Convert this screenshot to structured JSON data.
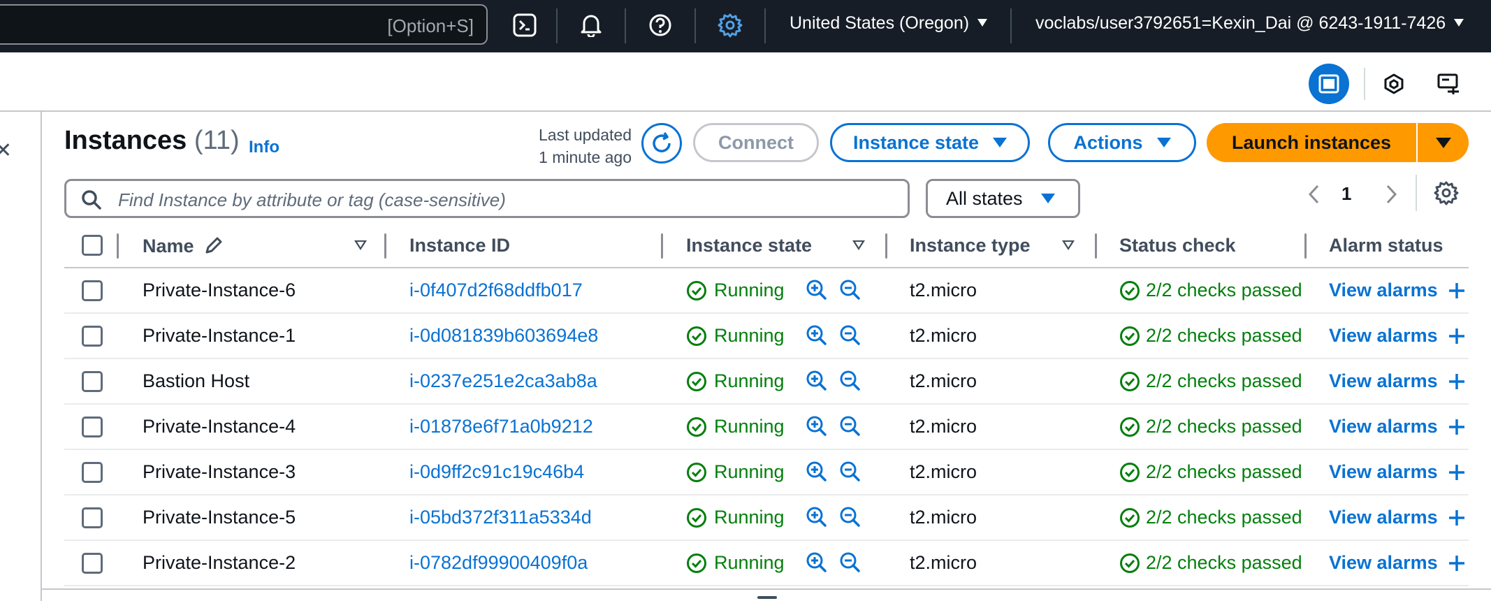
{
  "topnav": {
    "search_shortcut": "[Option+S]",
    "region": "United States (Oregon)",
    "account": "voclabs/user3792651=Kexin_Dai @ 6243-1911-7426"
  },
  "header": {
    "title": "Instances",
    "count": "(11)",
    "info": "Info",
    "last_updated_line1": "Last updated",
    "last_updated_line2": "1 minute ago"
  },
  "buttons": {
    "connect": "Connect",
    "instance_state": "Instance state",
    "actions": "Actions",
    "launch": "Launch instances"
  },
  "filter": {
    "placeholder": "Find Instance by attribute or tag (case-sensitive)",
    "state_select": "All states"
  },
  "pagination": {
    "current_page": "1"
  },
  "columns": {
    "name": "Name",
    "instance_id": "Instance ID",
    "instance_state": "Instance state",
    "instance_type": "Instance type",
    "status_check": "Status check",
    "alarm_status": "Alarm status"
  },
  "rows": [
    {
      "name": "Private-Instance-6",
      "id": "i-0f407d2f68ddfb017",
      "state": "Running",
      "type": "t2.micro",
      "status": "2/2 checks passed",
      "alarm": "View alarms"
    },
    {
      "name": "Private-Instance-1",
      "id": "i-0d081839b603694e8",
      "state": "Running",
      "type": "t2.micro",
      "status": "2/2 checks passed",
      "alarm": "View alarms"
    },
    {
      "name": "Bastion Host",
      "id": "i-0237e251e2ca3ab8a",
      "state": "Running",
      "type": "t2.micro",
      "status": "2/2 checks passed",
      "alarm": "View alarms"
    },
    {
      "name": "Private-Instance-4",
      "id": "i-01878e6f71a0b9212",
      "state": "Running",
      "type": "t2.micro",
      "status": "2/2 checks passed",
      "alarm": "View alarms"
    },
    {
      "name": "Private-Instance-3",
      "id": "i-0d9ff2c91c19c46b4",
      "state": "Running",
      "type": "t2.micro",
      "status": "2/2 checks passed",
      "alarm": "View alarms"
    },
    {
      "name": "Private-Instance-5",
      "id": "i-05bd372f311a5334d",
      "state": "Running",
      "type": "t2.micro",
      "status": "2/2 checks passed",
      "alarm": "View alarms"
    },
    {
      "name": "Private-Instance-2",
      "id": "i-0782df99900409f0a",
      "state": "Running",
      "type": "t2.micro",
      "status": "2/2 checks passed",
      "alarm": "View alarms"
    }
  ],
  "colors": {
    "nav_bg": "#161d26",
    "link_blue": "#0972d3",
    "success_green": "#037f0c",
    "launch_orange": "#ff9900"
  },
  "icons": [
    "cloudshell-icon",
    "bell-icon",
    "help-icon",
    "settings-gear-icon",
    "panel-icon",
    "hexagon-icon",
    "screen-icon",
    "refresh-icon",
    "search-icon",
    "pencil-icon",
    "check-circle-icon",
    "zoom-in-icon",
    "zoom-out-icon",
    "plus-icon"
  ]
}
